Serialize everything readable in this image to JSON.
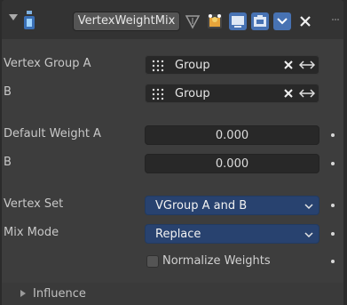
{
  "modifier": {
    "name": "VertexWeightMix",
    "name_color": "#e6e6e6"
  },
  "rows": {
    "vertex_group_a": {
      "label": "Vertex Group A",
      "value": "Group"
    },
    "vertex_group_b": {
      "label": "B",
      "value": "Group"
    },
    "default_weight_a": {
      "label": "Default Weight A",
      "value": "0.000"
    },
    "default_weight_b": {
      "label": "B",
      "value": "0.000"
    },
    "vertex_set": {
      "label": "Vertex Set",
      "value": "VGroup A and B"
    },
    "mix_mode": {
      "label": "Mix Mode",
      "value": "Replace"
    },
    "normalize": {
      "label": "Normalize Weights",
      "checked": false
    }
  },
  "subpanel": {
    "label": "Influence",
    "expanded": false
  },
  "colors": {
    "accent": "#4772b3",
    "menu_bg": "#28426f",
    "panel_bg": "#3d3d3d"
  },
  "icons": {
    "collapse": "triangle-down-icon",
    "modifier_type": "vertex-weight-icon",
    "invert": "invert-triangle-icon",
    "edit_mode": "edit-mode-icon",
    "realtime": "monitor-icon",
    "render": "camera-icon",
    "extra": "chevron-down-icon",
    "delete": "close-icon",
    "drag": "drag-handle-icon",
    "group": "vertex-group-icon",
    "clear": "clear-x-icon",
    "swap": "swap-arrows-icon"
  }
}
